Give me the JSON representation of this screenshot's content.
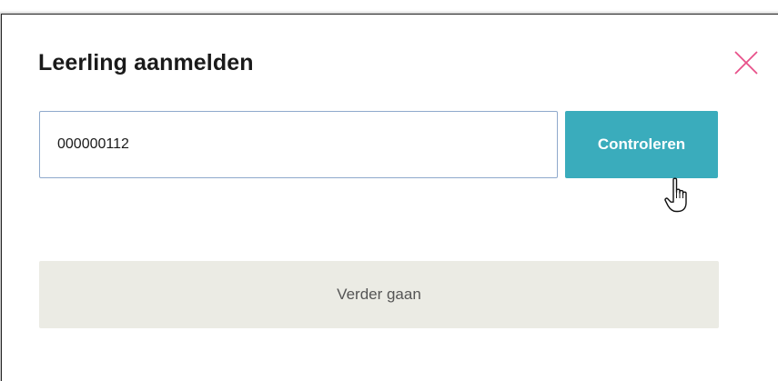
{
  "modal": {
    "title": "Leerling aanmelden",
    "close_icon": "close-icon"
  },
  "student_number": {
    "value": "000000112",
    "placeholder": ""
  },
  "buttons": {
    "check_label": "Controleren",
    "continue_label": "Verder gaan"
  },
  "colors": {
    "accent": "#3aacbc",
    "close": "#e8508a",
    "disabled_button": "#ebebe4",
    "input_border": "#8fa9cc"
  },
  "cursor_icon": "hand-pointer-icon"
}
